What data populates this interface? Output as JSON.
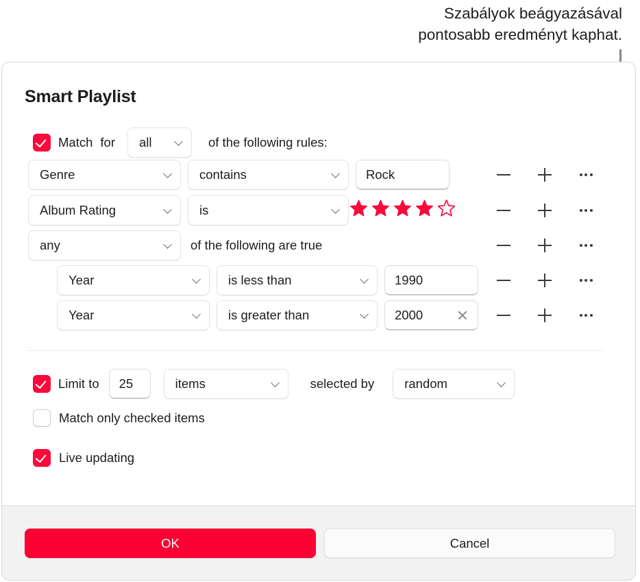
{
  "callout": {
    "text": "Szabályok beágyazásával\npontosabb eredményt kaphat."
  },
  "dialog": {
    "title": "Smart Playlist",
    "match_row": {
      "checkbox_checked": true,
      "label_before": "Match",
      "label_for": "for",
      "match_scope": "all",
      "label_after": "of the following rules:"
    },
    "rules": [
      {
        "field": "Genre",
        "operator": "contains",
        "value_type": "text",
        "value": "Rock",
        "has_clear": false,
        "nested": false
      },
      {
        "field": "Album Rating",
        "operator": "is",
        "value_type": "stars",
        "stars_filled": 4,
        "stars_total": 5,
        "nested": false
      }
    ],
    "nested_group": {
      "scope": "any",
      "label": "of the following are true",
      "rules": [
        {
          "field": "Year",
          "operator": "is less than",
          "value_type": "text",
          "value": "1990",
          "has_clear": false,
          "nested": true
        },
        {
          "field": "Year",
          "operator": "is greater than",
          "value_type": "text",
          "value": "2000",
          "has_clear": true,
          "nested": true
        }
      ]
    },
    "row_actions": {
      "remove": "remove-rule",
      "add": "add-rule",
      "more": "more-options"
    },
    "options": {
      "limit": {
        "checked": true,
        "label": "Limit to",
        "amount": "25",
        "unit": "items",
        "selected_by_label": "selected by",
        "selected_by": "random"
      },
      "match_only_checked": {
        "checked": false,
        "label": "Match only checked items"
      },
      "live_updating": {
        "checked": true,
        "label": "Live updating"
      }
    },
    "footer": {
      "ok": "OK",
      "cancel": "Cancel"
    }
  },
  "colors": {
    "accent_red": "#fa0a3c",
    "ok_button": "#fa0033",
    "star_red": "#fa0a3c",
    "callout_gray": "#86868b",
    "footer_bg": "#f2f2f2"
  }
}
